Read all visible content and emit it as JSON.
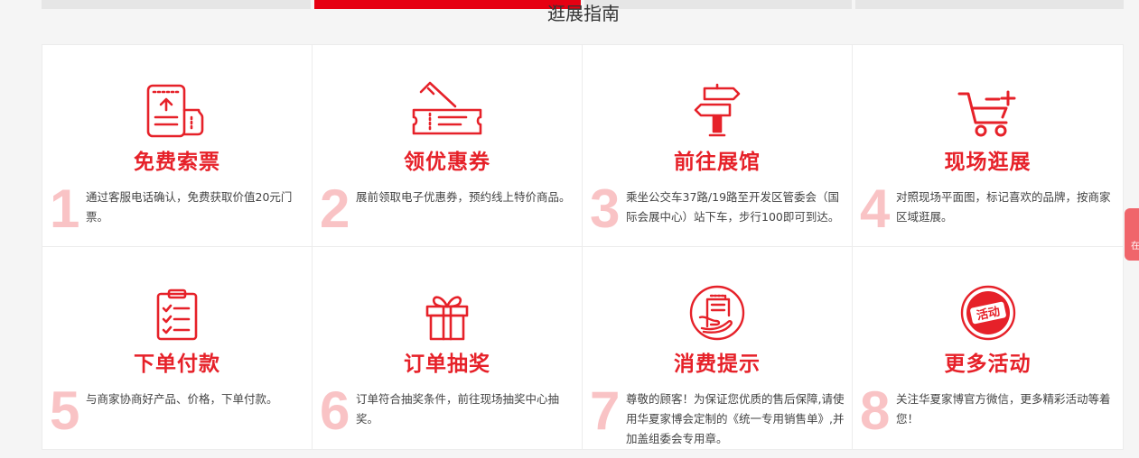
{
  "header": {
    "section_title": "逛展指南",
    "tabs": [
      "",
      "",
      "",
      ""
    ],
    "active_tab": 1
  },
  "colors": {
    "accent": "#e62129",
    "number": "#f9c3c5",
    "tab_active": "#e60012",
    "tab_inactive": "#e6e6e6"
  },
  "cards": [
    {
      "icon": "ticket-icon",
      "title": "免费索票",
      "num": "1",
      "desc": "通过客服电话确认，免费获取价值20元门票。"
    },
    {
      "icon": "coupon-icon",
      "title": "领优惠券",
      "num": "2",
      "desc": "展前领取电子优惠券，预约线上特价商品。"
    },
    {
      "icon": "signpost-icon",
      "title": "前往展馆",
      "num": "3",
      "desc": "乘坐公交车37路/19路至开发区管委会（国际会展中心）站下车，步行100即可到达。"
    },
    {
      "icon": "shopping-cart-icon",
      "title": "现场逛展",
      "num": "4",
      "desc": "对照现场平面图，标记喜欢的品牌，按商家区域逛展。"
    },
    {
      "icon": "clipboard-checklist-icon",
      "title": "下单付款",
      "num": "5",
      "desc": "与商家协商好产品、价格，下单付款。"
    },
    {
      "icon": "gift-icon",
      "title": "订单抽奖",
      "num": "6",
      "desc": "订单符合抽奖条件，前往现场抽奖中心抽奖。"
    },
    {
      "icon": "receipt-hand-icon",
      "title": "消费提示",
      "num": "7",
      "desc": "尊敬的顾客！为保证您优质的售后保障,请使用华夏家博会定制的《统一专用销售单》,并加盖组委会专用章。"
    },
    {
      "icon": "activity-badge-icon",
      "title": "更多活动",
      "num": "8",
      "desc": "关注华夏家博官方微信，更多精彩活动等着您！",
      "badge_text": "活动"
    }
  ],
  "side_float": {
    "label": "在"
  }
}
